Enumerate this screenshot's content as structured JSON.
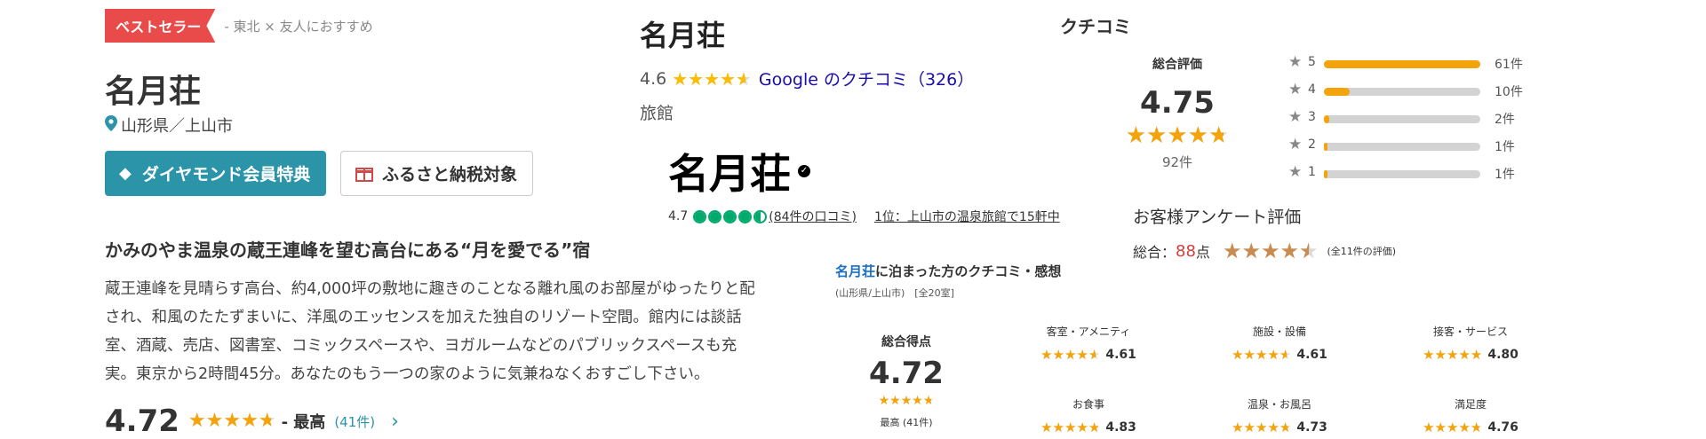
{
  "col1": {
    "badge": "ベストセラー",
    "tag": "- 東北 × 友人におすすめ",
    "hotel_name": "名月荘",
    "location": "山形県／上山市",
    "btn_diamond": "ダイヤモンド会員特典",
    "btn_furusato": "ふるさと納税対象",
    "headline": "かみのやま温泉の蔵王連峰を望む高台にある“月を愛でる”宿",
    "description_lines": [
      "蔵王連峰を見晴らす高台、約4,000坪の敷地に趣きのことなる離れ風のお部屋がゆったりと配",
      "され、和風のたたずまいに、洋風のエッセンスを加えた独自のリゾート空間。館内には談話",
      "室、酒蔵、売店、図書室、コミックスペースや、ヨガルームなどのパブリックスペースも充",
      "実。東京から2時間45分。あなたのもう一つの家のように気兼ねなくおすごし下さい。"
    ],
    "score": "4.72",
    "score_value": 4.72,
    "score_label": "- 最高",
    "score_count": "(41件)",
    "chevron": "›"
  },
  "google": {
    "name": "名月荘",
    "rating": "4.6",
    "rating_value": 4.6,
    "link": "Google のクチコミ（326）",
    "category": "旅館"
  },
  "tripadvisor": {
    "name": "名月荘",
    "rating": "4.7",
    "rating_value": 4.5,
    "reviews_link": "(84件の口コミ)",
    "rank_link": "1位：上山市の温泉旅館で15軒中"
  },
  "survey": {
    "title": "お客様アンケート評価",
    "overall_label": "総合：",
    "overall_score": "88",
    "overall_unit": "点",
    "overall_stars": 4.5,
    "count": "(全11件の評価)"
  },
  "kuchikomi": {
    "title": "クチコミ",
    "overall_label": "総合評価",
    "score": "4.75",
    "score_value": 4.75,
    "count": "92件",
    "bars": [
      {
        "label": "5",
        "count": "61件",
        "value": 61
      },
      {
        "label": "4",
        "count": "10件",
        "value": 10
      },
      {
        "label": "3",
        "count": "2件",
        "value": 2
      },
      {
        "label": "2",
        "count": "1件",
        "value": 1
      },
      {
        "label": "1",
        "count": "1件",
        "value": 1
      }
    ],
    "max": 61
  },
  "jalan": {
    "name_link": "名月荘",
    "title_suffix": "に泊まった方のクチコミ・感想",
    "sub": "(山形県/上山市)　[全20室]",
    "overall_label": "総合得点",
    "overall_score": "4.72",
    "overall_value": 4.72,
    "overall_note": "最高 (41件)",
    "categories": [
      {
        "label": "客室・アメニティ",
        "score": "4.61",
        "value": 4.61
      },
      {
        "label": "施設・設備",
        "score": "4.61",
        "value": 4.61
      },
      {
        "label": "接客・サービス",
        "score": "4.80",
        "value": 4.8
      },
      {
        "label": "お食事",
        "score": "4.83",
        "value": 4.83
      },
      {
        "label": "温泉・お風呂",
        "score": "4.73",
        "value": 4.73
      },
      {
        "label": "満足度",
        "score": "4.76",
        "value": 4.76
      }
    ]
  },
  "colors": {
    "star_orange": "#f5a30a",
    "star_tan": "#c98b4f",
    "link_blue": "#1a0dab",
    "teal": "#2b94a8",
    "red_badge": "#e94b4b",
    "ta_green": "#00aa6c"
  }
}
